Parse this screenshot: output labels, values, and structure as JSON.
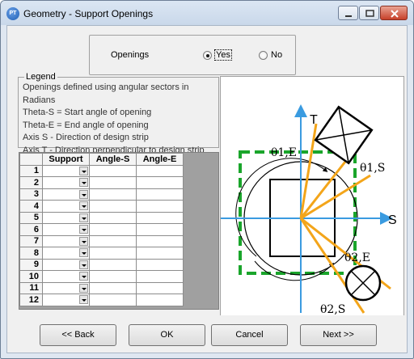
{
  "window": {
    "title": "Geometry - Support Openings",
    "app_icon_text": "PT"
  },
  "openings": {
    "label": "Openings",
    "options": [
      "Yes",
      "No"
    ],
    "selected": "Yes"
  },
  "legend": {
    "title": "Legend",
    "lines": [
      "Openings defined using angular sectors in Radians",
      "Theta-S = Start angle of opening",
      "Theta-E = End angle of opening",
      "Axis S - Direction of design strip",
      "Axis T - Direction perpendicular to design strip"
    ]
  },
  "grid": {
    "columns": [
      "",
      "Support",
      "Angle-S",
      "Angle-E"
    ],
    "rows": [
      "1",
      "2",
      "3",
      "4",
      "5",
      "6",
      "7",
      "8",
      "9",
      "10",
      "11",
      "12"
    ]
  },
  "diagram": {
    "axis_t": "T",
    "axis_s": "S",
    "theta_1e": "θ1,E",
    "theta_1s": "θ1,S",
    "theta_2e": "θ2,E",
    "theta_2s": "θ2,S",
    "colors": {
      "axis": "#3a9be0",
      "sector": "#f3a51a",
      "boundary": "#1aa52b"
    }
  },
  "buttons": {
    "back": "<< Back",
    "ok": "OK",
    "cancel": "Cancel",
    "next": "Next >>"
  }
}
